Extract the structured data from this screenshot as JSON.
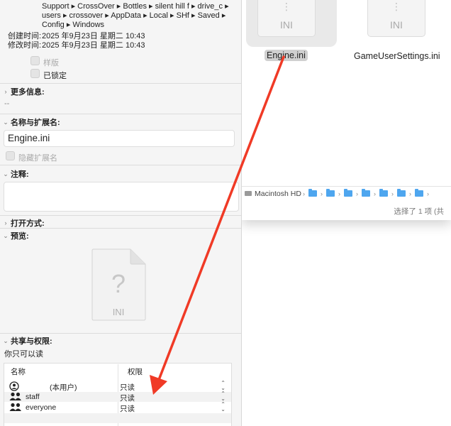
{
  "info_panel": {
    "where_lines": [
      "Support ▸ CrossOver ▸ Bottles ▸ silent hill f ▸ drive_c ▸",
      "users ▸ crossover ▸ AppData ▸ Local ▸ SHf ▸ Saved ▸",
      "Config ▸ Windows"
    ],
    "created_label": "创建时间:",
    "created_value": "2025 年9月23日 星期二 10:43",
    "modified_label": "修改时间:",
    "modified_value": "2025 年9月23日 星期二 10:43",
    "stationery_label": "样版",
    "locked_label": "已锁定",
    "more_info": {
      "title": "更多信息:",
      "value": "--"
    },
    "name_ext": {
      "title": "名称与扩展名:",
      "filename": "Engine.ini",
      "hide_ext_label": "隐藏扩展名"
    },
    "comments": {
      "title": "注释:"
    },
    "open_with": {
      "title": "打开方式:"
    },
    "preview": {
      "title": "预览:",
      "icon_ext": "INI"
    },
    "sharing": {
      "title": "共享与权限:",
      "status": "你只可以读",
      "col_name": "名称",
      "col_privilege": "权限",
      "rows": [
        {
          "name": "(本用户)",
          "privilege": "只读",
          "icon": "single-user-icon"
        },
        {
          "name": "staff",
          "privilege": "只读",
          "icon": "group-icon"
        },
        {
          "name": "everyone",
          "privilege": "只读",
          "icon": "group-icon"
        }
      ]
    }
  },
  "finder": {
    "files": [
      {
        "name": "Engine.ini",
        "ext": "INI",
        "selected": true
      },
      {
        "name": "GameUserSettings.ini",
        "ext": "INI",
        "selected": false
      }
    ],
    "path_root": "Macintosh HD",
    "status": "选择了 1 项 (共"
  },
  "colors": {
    "arrow": "#f03a26",
    "folder": "#4ea6ef"
  }
}
